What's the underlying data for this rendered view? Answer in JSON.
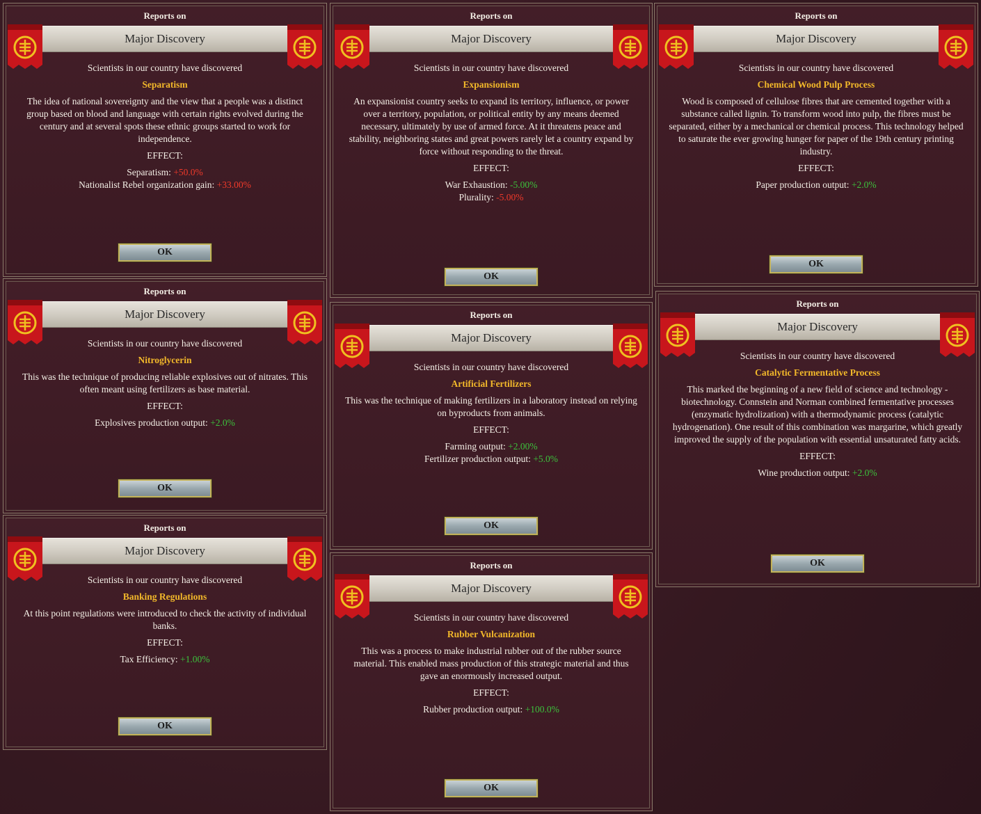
{
  "common": {
    "reports_on": "Reports on",
    "title": "Major Discovery",
    "intro": "Scientists in our country have discovered",
    "effect_label": "EFFECT:",
    "ok": "OK"
  },
  "panels": [
    {
      "tech": "Separatism",
      "desc": "The idea of national sovereignty and the view that a people was a distinct group based on blood and language with certain rights evolved during the century and at several spots these ethnic groups started to work for independence.",
      "effects": [
        {
          "label": "Separatism:",
          "value": "+50.0%",
          "kind": "neg"
        },
        {
          "label": "Nationalist Rebel organization gain:",
          "value": "+33.00%",
          "kind": "neg"
        }
      ]
    },
    {
      "tech": "Expansionism",
      "desc": "An expansionist country seeks to expand its territory, influence, or power over a territory, population, or political entity by any means deemed necessary, ultimately by use of armed force. At it threatens peace and stability, neighboring states and great powers rarely let a country expand by force without responding to the threat.",
      "effects": [
        {
          "label": "War Exhaustion:",
          "value": "-5.00%",
          "kind": "pos"
        },
        {
          "label": "Plurality:",
          "value": "-5.00%",
          "kind": "neg"
        }
      ]
    },
    {
      "tech": "Chemical Wood Pulp Process",
      "desc": "Wood is composed of cellulose fibres that are cemented together with a substance called lignin. To transform wood into pulp, the fibres must be separated, either by a mechanical or chemical process. This technology helped to saturate the ever growing hunger for paper of the 19th century printing industry.",
      "effects": [
        {
          "label": "Paper production output:",
          "value": "+2.0%",
          "kind": "pos"
        }
      ]
    },
    {
      "tech": "Nitroglycerin",
      "desc": "This was the technique of producing reliable explosives out of nitrates. This often meant using fertilizers as base material.",
      "effects": [
        {
          "label": "Explosives production output:",
          "value": "+2.0%",
          "kind": "pos"
        }
      ]
    },
    {
      "tech": "Artificial Fertilizers",
      "desc": "This was the technique of making fertilizers in a laboratory instead on relying on byproducts from animals.",
      "effects": [
        {
          "label": "Farming output:",
          "value": "+2.00%",
          "kind": "pos"
        },
        {
          "label": "Fertilizer production output:",
          "value": "+5.0%",
          "kind": "pos"
        }
      ]
    },
    {
      "tech": "Catalytic Fermentative Process",
      "desc": "This marked the beginning of a new field of science and technology  - biotechnology. Connstein and Norman combined fermentative processes (enzymatic hydrolization) with a thermodynamic process (catalytic hydrogenation). One result of this combination was margarine, which greatly improved the supply of the population with essential unsaturated fatty acids.",
      "effects": [
        {
          "label": "Wine production output:",
          "value": "+2.0%",
          "kind": "pos"
        }
      ]
    },
    {
      "tech": "Banking Regulations",
      "desc": "At this point regulations were introduced to check the activity of individual banks.",
      "effects": [
        {
          "label": "Tax Efficiency: ",
          "value": "+1.00%",
          "kind": "pos"
        }
      ]
    },
    {
      "tech": "Rubber Vulcanization",
      "desc": "This was a process to make industrial rubber out of the rubber source material. This enabled mass production of this strategic material and thus gave an enormously increased output.",
      "effects": [
        {
          "label": "Rubber production output:",
          "value": "+100.0%",
          "kind": "pos"
        }
      ]
    }
  ],
  "colors": {
    "tech_name": "#f2b82a",
    "negative": "#f03a2a",
    "positive": "#3cc23c",
    "banner_red": "#c8161c",
    "emblem_gold": "#f0c020"
  },
  "icons": [
    "banner-emblem-icon"
  ]
}
